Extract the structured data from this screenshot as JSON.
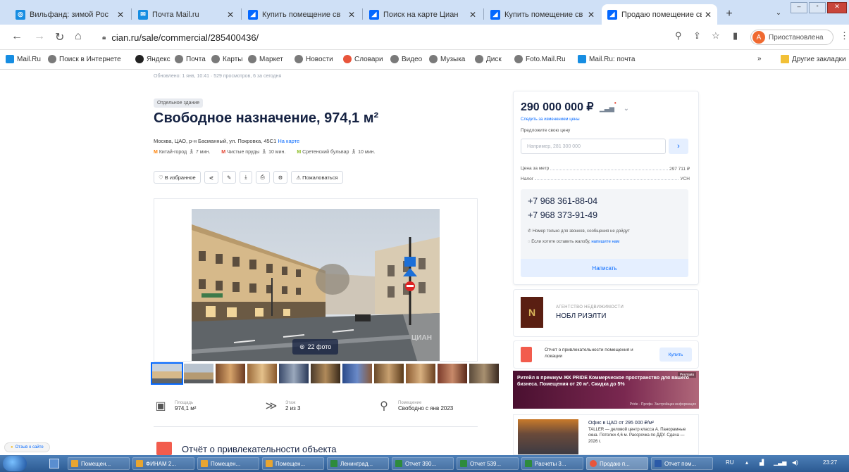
{
  "browser": {
    "tabs": [
      {
        "title": "Вильфанд: зимой Рос",
        "icon_color": "#168de2",
        "icon_label": "◎"
      },
      {
        "title": "Почта Mail.ru",
        "icon_color": "#168de2",
        "icon_label": "✉"
      },
      {
        "title": "Купить помещение св",
        "icon_color": "#0468ff",
        "icon_label": "◢"
      },
      {
        "title": "Поиск на карте Циан",
        "icon_color": "#0468ff",
        "icon_label": "◢"
      },
      {
        "title": "Купить помещение св",
        "icon_color": "#0468ff",
        "icon_label": "◢"
      },
      {
        "title": "Продаю помещение св",
        "icon_color": "#0468ff",
        "icon_label": "◢"
      }
    ],
    "url": "cian.ru/sale/commercial/285400436/",
    "profile_initial": "А",
    "profile_label": "Приостановлена",
    "bookmarks": [
      {
        "label": "Mail.Ru",
        "color": "#168de2"
      },
      {
        "label": "Поиск в Интернете",
        "color": "#7a7a7a"
      },
      {
        "label": "Яндекс",
        "color": "#222222"
      },
      {
        "label": "Почта",
        "color": "#7a7a7a"
      },
      {
        "label": "Карты",
        "color": "#7a7a7a"
      },
      {
        "label": "Маркет",
        "color": "#7a7a7a"
      },
      {
        "label": "Новости",
        "color": "#7a7a7a"
      },
      {
        "label": "Словари",
        "color": "#e8553b"
      },
      {
        "label": "Видео",
        "color": "#7a7a7a"
      },
      {
        "label": "Музыка",
        "color": "#7a7a7a"
      },
      {
        "label": "Диск",
        "color": "#7a7a7a"
      },
      {
        "label": "Foto.Mail.Ru",
        "color": "#7a7a7a"
      },
      {
        "label": "Mail.Ru: почта",
        "color": "#168de2"
      }
    ],
    "other_bookmarks": "Другие закладки",
    "more": "»"
  },
  "listing": {
    "meta": "Обновлено: 1 янв, 10:41 · 529 просмотров, 6 за сегодня",
    "badge": "Отдельное здание",
    "title": "Свободное назначение, 974,1 м²",
    "address": "Москва, ЦАО, р-н Басманный, ул. Покровка, 45С1",
    "map_link": "На карте",
    "metros": [
      {
        "name": "Китай-город",
        "time": "7 мин.",
        "color": "#ff8103"
      },
      {
        "name": "Чистые пруды",
        "time": "10 мин.",
        "color": "#e4402d"
      },
      {
        "name": "Сретенский бульвар",
        "time": "10 мин.",
        "color": "#8dbe27"
      }
    ],
    "actions": {
      "favorite": "♡ В избранное",
      "share": "⋞",
      "edit": "✎",
      "download": "⤓",
      "print": "⎙",
      "settings": "⚙",
      "complain": "⚠ Пожаловаться"
    },
    "photo_count": "22 фото",
    "watermark": "ЦИАН",
    "params": [
      {
        "label": "Площадь",
        "value": "974,1 м²",
        "icon": "▣"
      },
      {
        "label": "Этаж",
        "value": "2 из 3",
        "icon": "≫"
      },
      {
        "label": "Помещение",
        "value": "Свободно с янв 2023",
        "icon": "⚲"
      }
    ],
    "report_title": "Отчёт о привлекательности объекта"
  },
  "price_card": {
    "price": "290 000 000 ₽",
    "follow_price": "Следить за изменением цены",
    "offer_label": "Предложите свою цену",
    "offer_placeholder": "Например, 281 300 000",
    "offer_go": "›",
    "rows": [
      {
        "k": "Цена за метр",
        "v": "297 711 ₽"
      },
      {
        "k": "Налог",
        "v": "УСН"
      }
    ],
    "phones": [
      "+7 968 361-88-04",
      "+7 968 373-91-49"
    ],
    "note1": "Номер только для звонков, сообщения не дойдут",
    "note2_prefix": "Если хотите оставить жалобу,",
    "note2_link": "напишите нам",
    "write": "Написать"
  },
  "agency": {
    "kind": "АГЕНТСТВО НЕДВИЖИМОСТИ",
    "name": "НОБЛ РИЭЛТИ",
    "logo_letter": "N"
  },
  "report_card": {
    "text": "Отчет о привлекательности помещения и локации",
    "button": "Купить"
  },
  "ad1": {
    "text": "Ритейл в премиум ЖК PRIDE Коммерческое пространство для вашего бизнеса. Помещения от 20 м². Скидка до 5%",
    "tag": "Реклама",
    "foot": "Pride · Профи. Застройщик информация"
  },
  "ad2": {
    "title": "Офис в ЦАО от 295 000 ₽/м²",
    "text": "TALLER — деловой центр класса А. Панорамные окна. Потолки 4,6 м. Рассрочка по ДДУ. Сдача — 2026 г."
  },
  "feedback": "Отзыв о сайте",
  "taskbar": {
    "items": [
      {
        "label": "Помещен...",
        "color": "#e8a530"
      },
      {
        "label": "ФИНАМ 2...",
        "color": "#e8a530"
      },
      {
        "label": "Помещен...",
        "color": "#e8a530"
      },
      {
        "label": "Помещен...",
        "color": "#e8a530"
      },
      {
        "label": "Ленинград...",
        "color": "#2e8b3c"
      },
      {
        "label": "Отчет 390...",
        "color": "#2e8b3c"
      },
      {
        "label": "Отчет 539...",
        "color": "#2e8b3c"
      },
      {
        "label": "Расчеты 3...",
        "color": "#2e8b3c"
      },
      {
        "label": "Продаю п...",
        "color": "#e8553b"
      },
      {
        "label": "Отчет пом...",
        "color": "#2b5aa8"
      }
    ],
    "lang": "RU",
    "clock": "23:27"
  }
}
